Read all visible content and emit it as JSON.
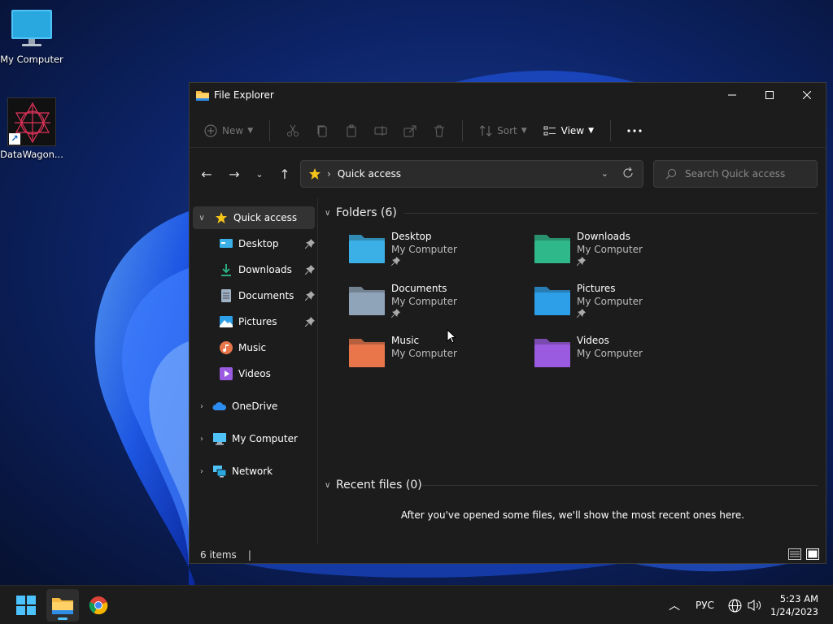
{
  "desktop": {
    "icons": [
      {
        "label": "My Computer"
      },
      {
        "label": "DataWagon..."
      }
    ]
  },
  "window": {
    "title": "File Explorer",
    "commandbar": {
      "new_label": "New",
      "sort_label": "Sort",
      "view_label": "View"
    },
    "address": {
      "current": "Quick access"
    },
    "search": {
      "placeholder": "Search Quick access"
    },
    "sidebar": {
      "quick_access": "Quick access",
      "pinned": [
        {
          "label": "Desktop",
          "icon": "desktop-icon"
        },
        {
          "label": "Downloads",
          "icon": "download-icon"
        },
        {
          "label": "Documents",
          "icon": "document-icon"
        },
        {
          "label": "Pictures",
          "icon": "pictures-icon"
        },
        {
          "label": "Music",
          "icon": "music-icon"
        },
        {
          "label": "Videos",
          "icon": "videos-icon"
        }
      ],
      "roots": [
        {
          "label": "OneDrive",
          "icon": "cloud-icon"
        },
        {
          "label": "My Computer",
          "icon": "computer-icon"
        },
        {
          "label": "Network",
          "icon": "network-icon"
        }
      ]
    },
    "content": {
      "folders_header": "Folders (6)",
      "folders": [
        {
          "name": "Desktop",
          "location": "My Computer",
          "color": "#3ab0e6"
        },
        {
          "name": "Downloads",
          "location": "My Computer",
          "color": "#2fb88a"
        },
        {
          "name": "Documents",
          "location": "My Computer",
          "color": "#8fa4b8"
        },
        {
          "name": "Pictures",
          "location": "My Computer",
          "color": "#2d9ee8"
        },
        {
          "name": "Music",
          "location": "My Computer",
          "color": "#e8764a"
        },
        {
          "name": "Videos",
          "location": "My Computer",
          "color": "#9a5be0"
        }
      ],
      "recent_header": "Recent files (0)",
      "empty_message": "After you've opened some files, we'll show the most recent ones here."
    },
    "status": {
      "items": "6 items"
    }
  },
  "taskbar": {
    "language": "РУС",
    "time": "5:23 AM",
    "date": "1/24/2023",
    "accent": "#4cc2ff"
  }
}
